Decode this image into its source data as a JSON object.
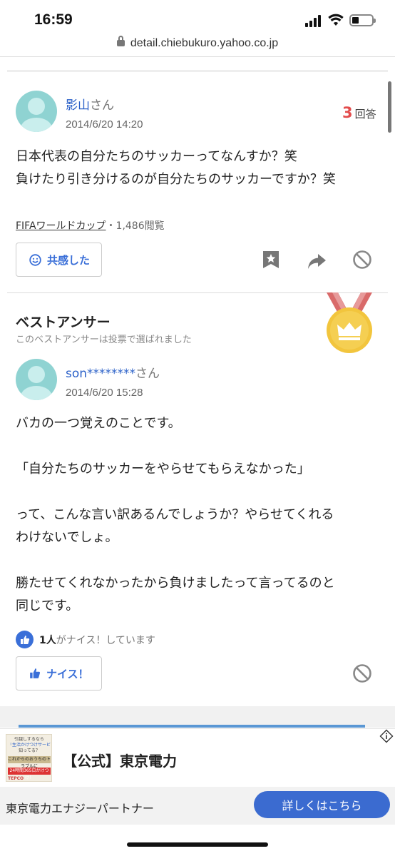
{
  "status_bar": {
    "time": "16:59"
  },
  "browser": {
    "url": "detail.chiebukuro.yahoo.co.jp"
  },
  "question": {
    "user_name": "影山",
    "user_suffix": "さん",
    "date": "2014/6/20 14:20",
    "answer_count": "3",
    "answer_label": "回答",
    "body": [
      "日本代表の自分たちのサッカーってなんすか？笑",
      "負けたり引き分けるのが自分たちのサッカーですか？笑"
    ],
    "tag": "FIFAワールドカップ",
    "views": "・1,486閲覧",
    "empathy_label": "共感した"
  },
  "best_answer": {
    "title": "ベストアンサー",
    "subtitle": "このベストアンサーは投票で選ばれました",
    "user_name": "son********",
    "user_suffix": "さん",
    "date": "2014/6/20 15:28",
    "paragraphs": [
      "バカの一つ覚えのことです。",
      "「自分たちのサッカーをやらせてもらえなかった」",
      "って、こんな言い訳あるんでしょうか？やらせてくれる\nわけないでしょ。",
      "勝たせてくれなかったから負けましたって言ってるのと\n同じです。"
    ],
    "nice_count": "1人",
    "nice_text": "がナイス！しています",
    "nice_label": "ナイス！"
  },
  "ad": {
    "thumb_line1": "引越しするなら",
    "thumb_line2": "「生活かけつけサービス」って",
    "thumb_line3": "知ってる？",
    "thumb_line4": "これからのおうちのトラブルに",
    "thumb_line5": "24時間365日かけつけ！",
    "thumb_brand": "TEPCO",
    "title": "【公式】東京電力",
    "company": "東京電力エナジーパートナー",
    "cta": "詳しくはこちら"
  },
  "colors": {
    "link_blue": "#2a60c8",
    "button_blue": "#3a6fd8",
    "count_red": "#e34c4c",
    "avatar_teal": "#8fd3d2",
    "medal_gold": "#f2c53d",
    "medal_ribbon": "#d96a6a"
  }
}
